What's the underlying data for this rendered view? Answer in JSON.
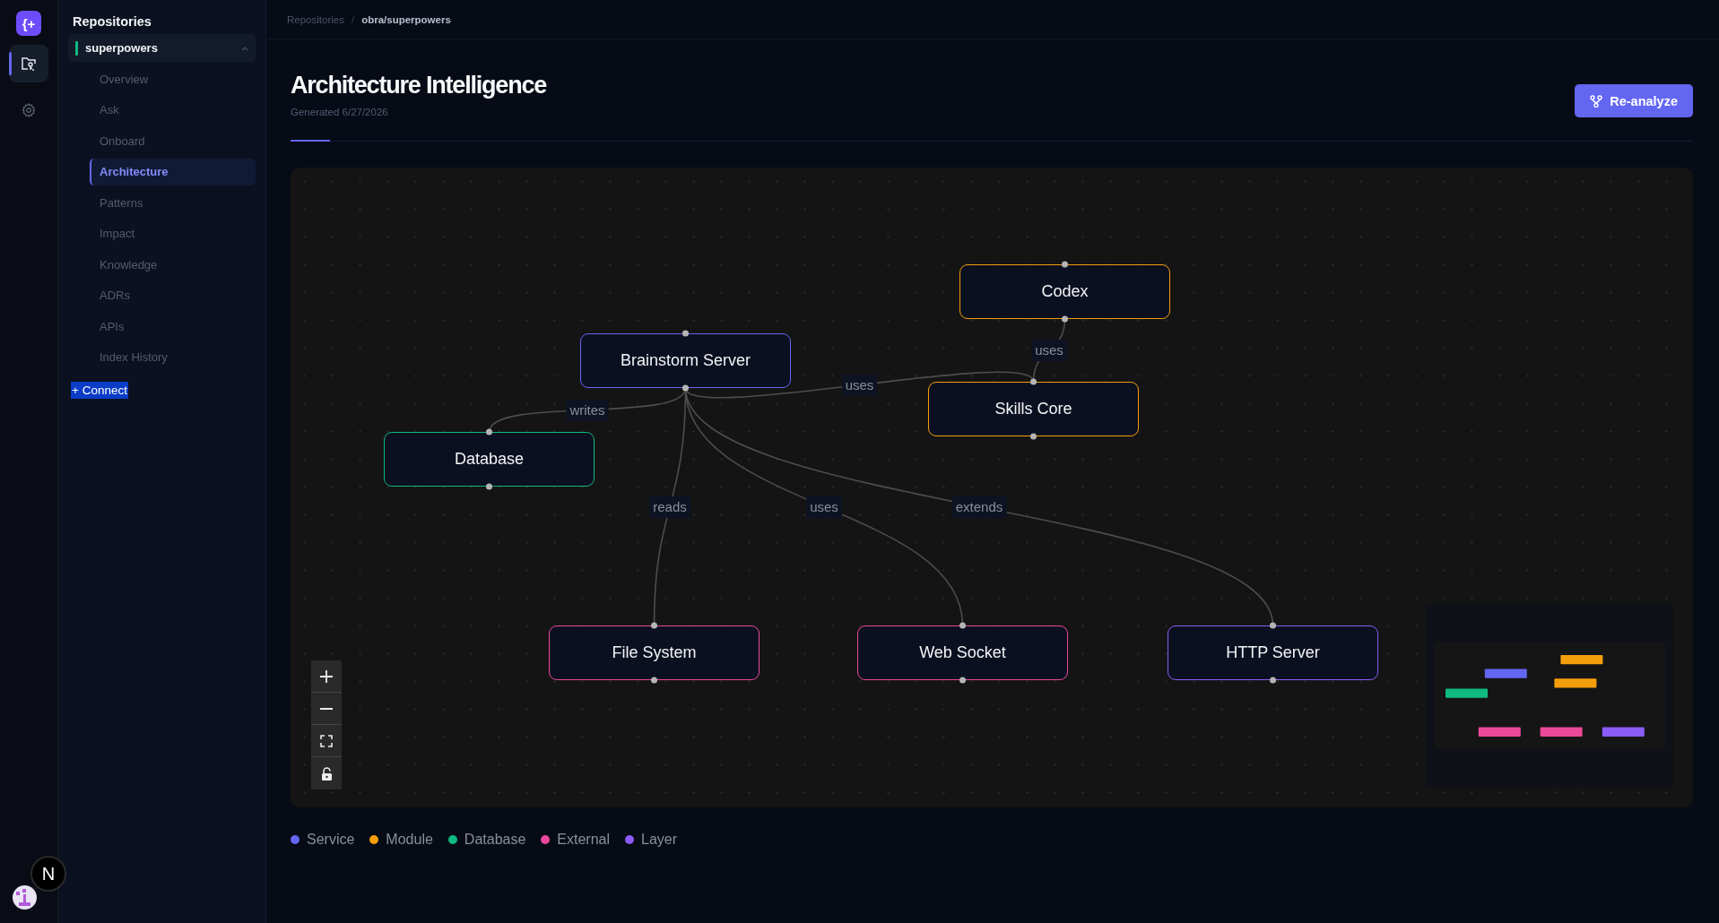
{
  "rail": {
    "logo": "{+",
    "items": [
      {
        "kind": "repositories",
        "selected": true
      },
      {
        "kind": "settings",
        "selected": false
      }
    ],
    "badge": "N"
  },
  "sidebar": {
    "title": "Repositories",
    "repo": {
      "name": "superpowers",
      "expanded": true
    },
    "nav": [
      {
        "label": "Overview",
        "selected": false
      },
      {
        "label": "Ask",
        "selected": false
      },
      {
        "label": "Onboard",
        "selected": false
      },
      {
        "label": "Architecture",
        "selected": true
      },
      {
        "label": "Patterns",
        "selected": false
      },
      {
        "label": "Impact",
        "selected": false
      },
      {
        "label": "Knowledge",
        "selected": false
      },
      {
        "label": "ADRs",
        "selected": false
      },
      {
        "label": "APIs",
        "selected": false
      },
      {
        "label": "Index History",
        "selected": false
      }
    ],
    "connect": "+ Connect"
  },
  "breadcrumb": {
    "items": [
      "Repositories",
      "obra/superpowers"
    ],
    "separator": "/"
  },
  "header": {
    "title": "Architecture Intelligence",
    "subtitle": "Generated 6/27/2026",
    "button": "Re-analyze"
  },
  "graph": {
    "locked": false,
    "nodes": [
      {
        "label": "Codex",
        "kind": "module"
      },
      {
        "label": "Brainstorm Server",
        "kind": "service"
      },
      {
        "label": "Skills Core",
        "kind": "module"
      },
      {
        "label": "Database",
        "kind": "database"
      },
      {
        "label": "File System",
        "kind": "external"
      },
      {
        "label": "Web Socket",
        "kind": "external"
      },
      {
        "label": "HTTP Server",
        "kind": "layer"
      }
    ],
    "edges": [
      {
        "label": "uses"
      },
      {
        "label": "uses"
      },
      {
        "label": "writes"
      },
      {
        "label": "reads"
      },
      {
        "label": "uses"
      },
      {
        "label": "extends"
      }
    ]
  },
  "legend": [
    {
      "label": "Service",
      "kind": "service",
      "color": "#6366f1"
    },
    {
      "label": "Module",
      "kind": "module",
      "color": "#f59e0b"
    },
    {
      "label": "Database",
      "kind": "database",
      "color": "#10b981"
    },
    {
      "label": "External",
      "kind": "external",
      "color": "#ec4899"
    },
    {
      "label": "Layer",
      "kind": "layer",
      "color": "#8b5cf6"
    }
  ]
}
